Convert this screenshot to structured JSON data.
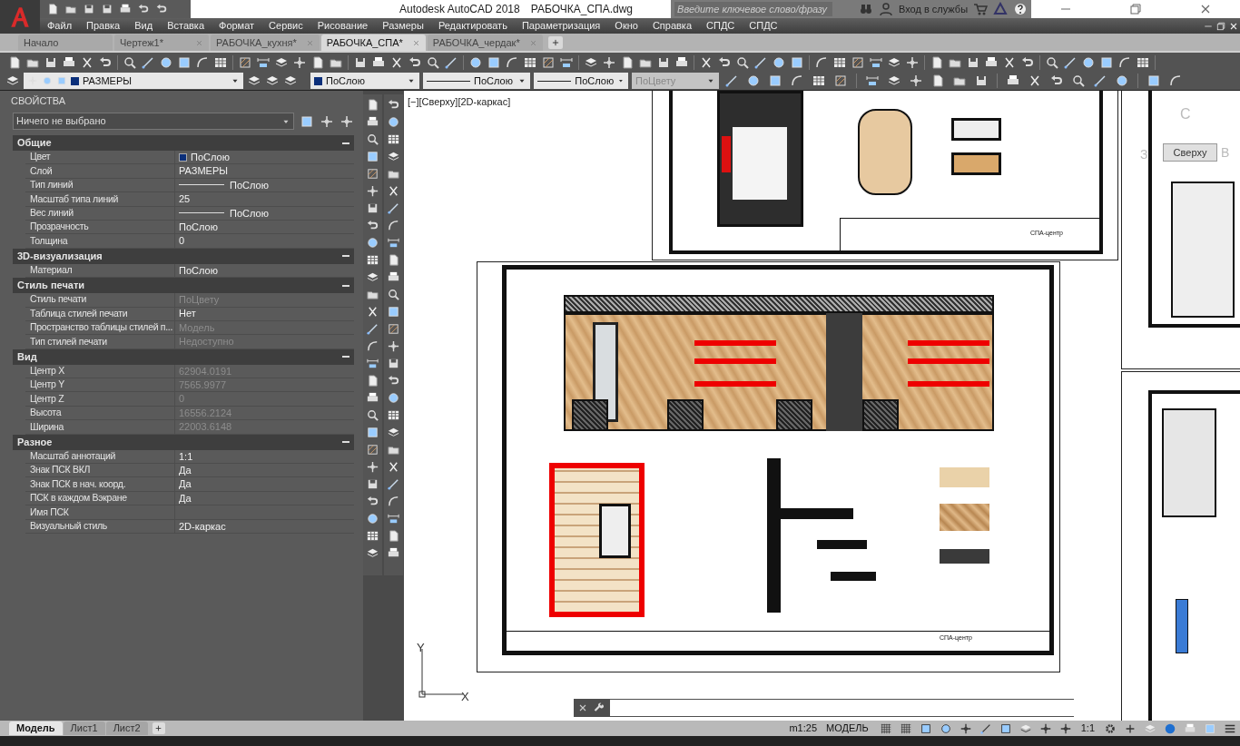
{
  "window": {
    "app_title": "Autodesk AutoCAD 2018",
    "file_name": "РАБОЧКА_СПА.dwg"
  },
  "search": {
    "placeholder": "Введите ключевое слово/фразу"
  },
  "sign_in": "Вход в службы",
  "menu": [
    "Файл",
    "Правка",
    "Вид",
    "Вставка",
    "Формат",
    "Сервис",
    "Рисование",
    "Размеры",
    "Редактировать",
    "Параметризация",
    "Окно",
    "Справка",
    "СПДС",
    "СПДС"
  ],
  "doc_tabs": [
    {
      "label": "Начало",
      "selected": false,
      "closable": false
    },
    {
      "label": "Чертеж1*",
      "selected": false,
      "closable": true
    },
    {
      "label": "РАБОЧКА_кухня*",
      "selected": false,
      "closable": true
    },
    {
      "label": "РАБОЧКА_СПА*",
      "selected": true,
      "closable": true
    },
    {
      "label": "РАБОЧКА_чердак*",
      "selected": false,
      "closable": true
    }
  ],
  "layer_toolbar": {
    "layer": "РАЗМЕРЫ",
    "color_setting": "ПоСлою",
    "linetype": "ПоСлою",
    "lineweight": "ПоСлою",
    "plot_style": "ПоЦвету"
  },
  "properties": {
    "title": "СВОЙСТВА",
    "selection": "Ничего не выбрано",
    "sections": [
      {
        "title": "Общие",
        "expanded": true,
        "rows": [
          {
            "label": "Цвет",
            "value": "ПоСлою",
            "kind": "swatch",
            "disabled": false
          },
          {
            "label": "Слой",
            "value": "РАЗМЕРЫ",
            "kind": "text",
            "disabled": false
          },
          {
            "label": "Тип линий",
            "value": "ПоСлою",
            "kind": "line",
            "disabled": false
          },
          {
            "label": "Масштаб типа линий",
            "value": "25",
            "kind": "text",
            "disabled": false
          },
          {
            "label": "Вес линий",
            "value": "ПоСлою",
            "kind": "line",
            "disabled": false
          },
          {
            "label": "Прозрачность",
            "value": "ПоСлою",
            "kind": "text",
            "disabled": false
          },
          {
            "label": "Толщина",
            "value": "0",
            "kind": "text",
            "disabled": false
          }
        ]
      },
      {
        "title": "3D-визуализация",
        "expanded": true,
        "rows": [
          {
            "label": "Материал",
            "value": "ПоСлою",
            "kind": "text",
            "disabled": false
          }
        ]
      },
      {
        "title": "Стиль печати",
        "expanded": true,
        "rows": [
          {
            "label": "Стиль печати",
            "value": "ПоЦвету",
            "kind": "text",
            "disabled": true
          },
          {
            "label": "Таблица стилей печати",
            "value": "Нет",
            "kind": "text",
            "disabled": false
          },
          {
            "label": "Пространство таблицы стилей п...",
            "value": "Модель",
            "kind": "text",
            "disabled": true
          },
          {
            "label": "Тип стилей печати",
            "value": "Недоступно",
            "kind": "text",
            "disabled": true
          }
        ]
      },
      {
        "title": "Вид",
        "expanded": true,
        "rows": [
          {
            "label": "Центр X",
            "value": "62904.0191",
            "kind": "text",
            "disabled": true
          },
          {
            "label": "Центр Y",
            "value": "7565.9977",
            "kind": "text",
            "disabled": true
          },
          {
            "label": "Центр Z",
            "value": "0",
            "kind": "text",
            "disabled": true
          },
          {
            "label": "Высота",
            "value": "16556.2124",
            "kind": "text",
            "disabled": true
          },
          {
            "label": "Ширина",
            "value": "22003.6148",
            "kind": "text",
            "disabled": true
          }
        ]
      },
      {
        "title": "Разное",
        "expanded": true,
        "rows": [
          {
            "label": "Масштаб аннотаций",
            "value": "1:1",
            "kind": "text",
            "disabled": false
          },
          {
            "label": "Знак ПСК ВКЛ",
            "value": "Да",
            "kind": "text",
            "disabled": false
          },
          {
            "label": "Знак ПСК в нач. коорд.",
            "value": "Да",
            "kind": "text",
            "disabled": false
          },
          {
            "label": "ПСК в каждом Вэкране",
            "value": "Да",
            "kind": "text",
            "disabled": false
          },
          {
            "label": "Имя ПСК",
            "kind": "text"
          },
          {
            "label": "Визуальный стиль",
            "value": "2D-каркас",
            "kind": "text",
            "disabled": false
          }
        ]
      }
    ]
  },
  "viewport_label": "[−][Сверху][2D-каркас]",
  "view_cube": {
    "north": "С",
    "west": "З",
    "east": "В",
    "face": "Сверху"
  },
  "title_blocks": [
    "СПА-центр",
    "СПА-центр"
  ],
  "ucs": {
    "x": "X",
    "y": "Y"
  },
  "layout_tabs": [
    {
      "label": "Модель",
      "selected": true
    },
    {
      "label": "Лист1",
      "selected": false
    },
    {
      "label": "Лист2",
      "selected": false
    }
  ],
  "status_bar": {
    "scale": "m1:25",
    "space": "МОДЕЛЬ",
    "annotation_scale": "1:1"
  }
}
